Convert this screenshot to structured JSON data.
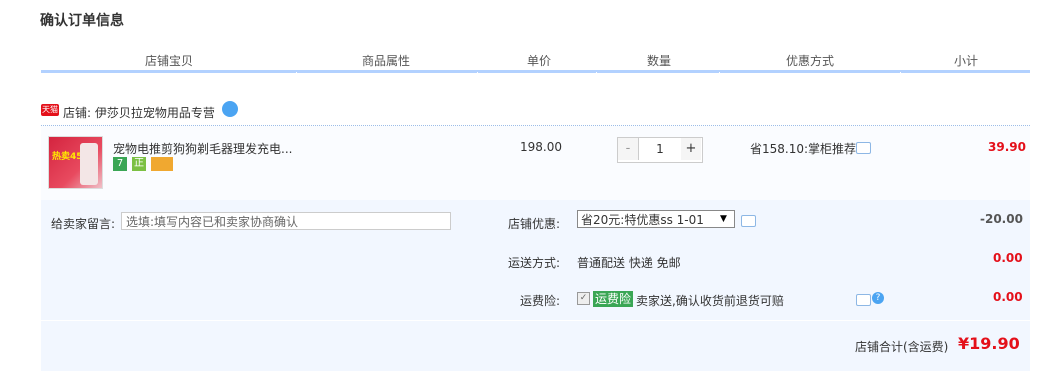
{
  "page_title": "确认订单信息",
  "columns": [
    "店铺宝贝",
    "商品属性",
    "单价",
    "数量",
    "优惠方式",
    "小计"
  ],
  "shop": {
    "badge": "天猫",
    "label": "店铺:",
    "name": "伊莎贝拉宠物用品专营"
  },
  "item": {
    "name": "宠物电推剪狗狗剃毛器理发充电...",
    "thumb_text": "热卖45万",
    "price": "198.00",
    "quantity": "1",
    "minus": "-",
    "plus": "+",
    "discount": "省158.10:掌柜推荐",
    "subtotal": "39.90",
    "service_icons": [
      {
        "name": "seven-day-return-icon",
        "text": "7",
        "color": "#3aa655"
      },
      {
        "name": "genuine-guarantee-icon",
        "text": "正",
        "color": "#7bc043"
      },
      {
        "name": "credit-card-icon",
        "text": "",
        "color": "#f0a830"
      }
    ]
  },
  "message": {
    "label": "给卖家留言:",
    "placeholder": "选填:填写内容已和卖家协商确认"
  },
  "shop_discount": {
    "label": "店铺优惠:",
    "selected": "省20元:特优惠ss 1-01",
    "amount": "-20.00"
  },
  "shipping": {
    "label": "运送方式:",
    "value": "普通配送 快递 免邮",
    "amount": "0.00"
  },
  "insurance": {
    "label": "运费险:",
    "badge": "运费险",
    "text": "卖家送,确认收货前退货可赔",
    "amount": "0.00"
  },
  "total": {
    "label": "店铺合计(含运费)",
    "value": "¥19.90"
  },
  "colors": {
    "accent": "#b2d1ff",
    "price_red": "#e4101a",
    "panel_bg": "#f2f7ff"
  }
}
